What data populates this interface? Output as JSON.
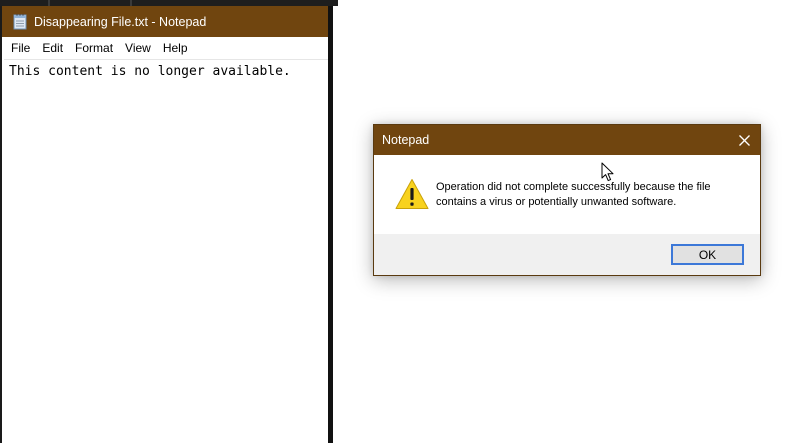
{
  "colors": {
    "titlebar": "#70450f",
    "titlebar_text": "#ffffff",
    "dialog_footer": "#f0f0f0",
    "ok_border": "#3c78d8",
    "warning_yellow": "#f8d21e"
  },
  "notepad": {
    "window_title": "Disappearing File.txt - Notepad",
    "app_icon": "notepad-icon",
    "menu": [
      "File",
      "Edit",
      "Format",
      "View",
      "Help"
    ],
    "content": "This content is no longer available."
  },
  "dialog": {
    "title": "Notepad",
    "close_icon": "close-icon",
    "icon": "warning-icon",
    "message": "Operation did not complete successfully because the file contains a virus or potentially unwanted software.",
    "ok_label": "OK"
  },
  "pointer": {
    "icon": "mouse-cursor-icon"
  }
}
